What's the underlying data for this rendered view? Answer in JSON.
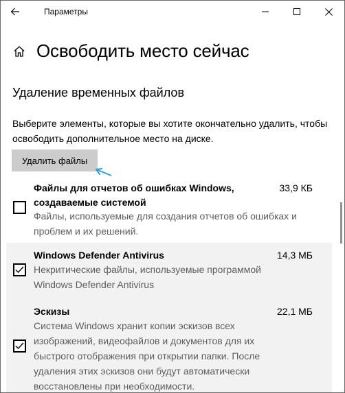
{
  "window": {
    "title": "Параметры"
  },
  "page": {
    "title": "Освободить место сейчас",
    "section_title": "Удаление временных файлов",
    "description": "Выберите элементы, которые вы хотите окончательно удалить, чтобы освободить дополнительное место на диске.",
    "delete_button_label": "Удалить файлы"
  },
  "items": [
    {
      "name_line1": "Файлы для отчетов об ошибках Windows,",
      "name_line2": "создаваемые системой",
      "size": "33,9 КБ",
      "description": "Файлы, используемые для создания отчетов об ошибках и проблем и их решений.",
      "checked": false
    },
    {
      "name_line1": "Windows Defender Antivirus",
      "size": "14,3 МБ",
      "description": "Некритические файлы, используемые программой Windows Defender Antivirus",
      "checked": true
    },
    {
      "name_line1": "Эскизы",
      "size": "22,1 МБ",
      "description": "Система Windows хранит копии эскизов всех изображений, видеофайлов и документов для их быстрого отображения при открытии папки. После удаления этих эскизов они будут автоматически восстановлены при необходимости.",
      "checked": true
    }
  ],
  "icons": {
    "back": "back-arrow-icon",
    "home": "home-icon",
    "minimize": "minimize-icon",
    "maximize": "maximize-icon",
    "close": "close-icon",
    "check": "checkmark-icon",
    "pointer": "cursor-arrow-icon"
  },
  "colors": {
    "button_bg": "#cccccc",
    "highlight_row": "#f2f2f2",
    "secondary_text": "#5d5d5d",
    "cursor_accent": "#2aa3d6"
  }
}
